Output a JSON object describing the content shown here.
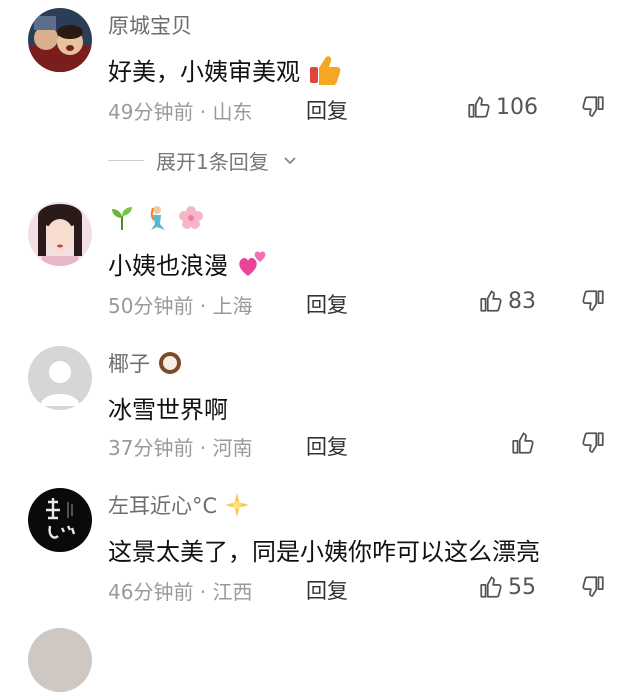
{
  "comments": [
    {
      "name": "原城宝贝",
      "text": "好美，小姨审美观",
      "time_location": "49分钟前 · 山东",
      "reply_label": "回复",
      "likes": "106",
      "expand_label": "展开1条回复"
    },
    {
      "name": "",
      "text": "小姨也浪漫",
      "time_location": "50分钟前 · 上海",
      "reply_label": "回复",
      "likes": "83"
    },
    {
      "name": "椰子",
      "text": "冰雪世界啊",
      "time_location": "37分钟前 · 河南",
      "reply_label": "回复",
      "likes": ""
    },
    {
      "name": "左耳近心°C",
      "text": "这景太美了，同是小姨你咋可以这么漂亮",
      "time_location": "46分钟前 · 江西",
      "reply_label": "回复",
      "likes": "55"
    }
  ],
  "colors": {
    "meta_gray": "#9a9a9a",
    "name_gray": "#6e6e6e",
    "heart_pink": "#e8459a",
    "thumb_orange": "#f5a623"
  }
}
